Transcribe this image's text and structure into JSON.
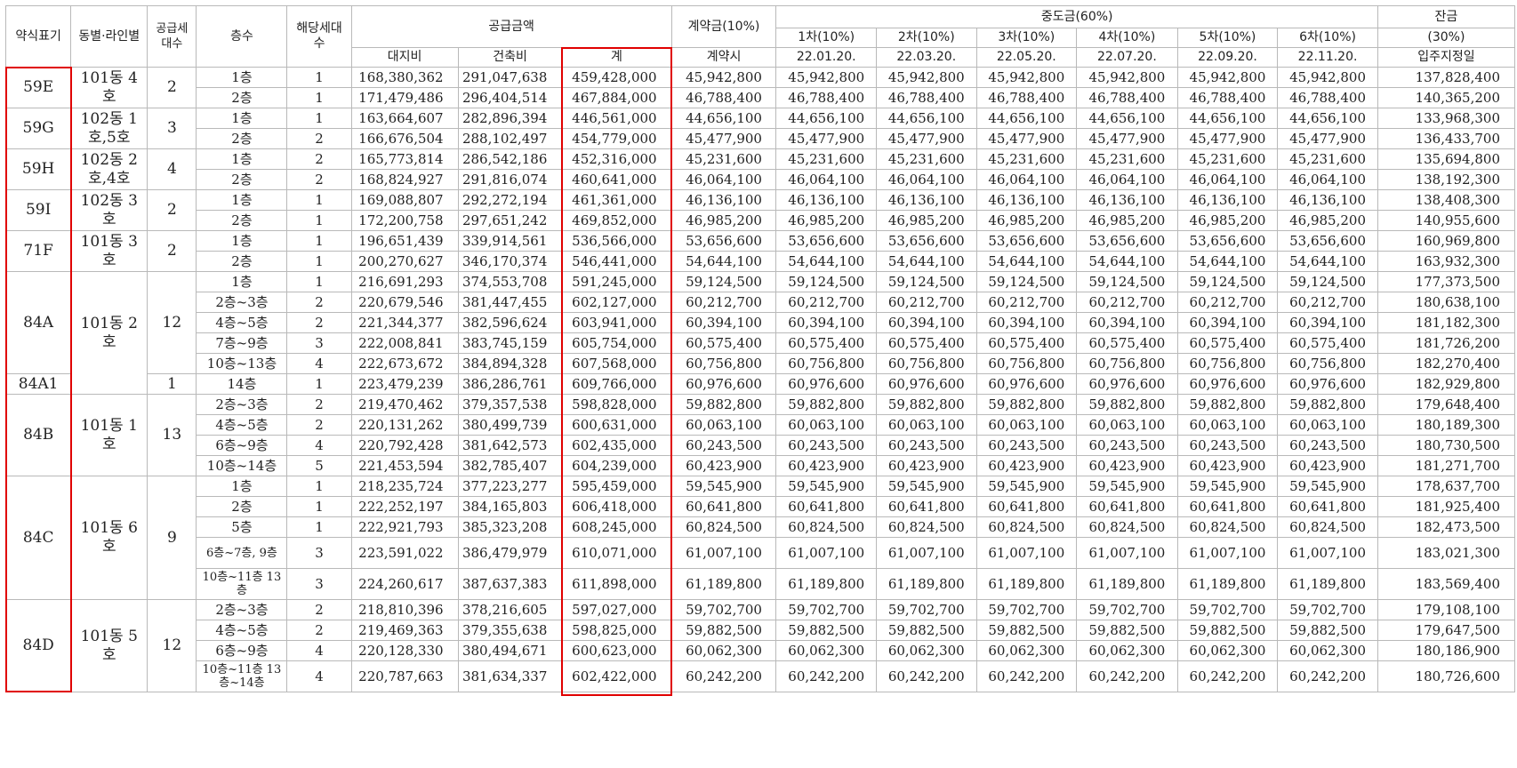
{
  "header": {
    "type": "약식표기",
    "dong_line": "동별·라인별",
    "units_total": "공급세대수",
    "floor": "층수",
    "units": "해당세대수",
    "supply": "공급금액",
    "land": "대지비",
    "building": "건축비",
    "total": "계",
    "contract": "계약금(10%)",
    "contract_sub": "계약시",
    "middle": "중도금(60%)",
    "middle_installments": [
      {
        "label": "1차(10%)",
        "date": "22.01.20."
      },
      {
        "label": "2차(10%)",
        "date": "22.03.20."
      },
      {
        "label": "3차(10%)",
        "date": "22.05.20."
      },
      {
        "label": "4차(10%)",
        "date": "22.07.20."
      },
      {
        "label": "5차(10%)",
        "date": "22.09.20."
      },
      {
        "label": "6차(10%)",
        "date": "22.11.20."
      }
    ],
    "balance_l1": "잔금",
    "balance_l2": "(30%)",
    "balance_sub": "입주지정일"
  },
  "groups": [
    {
      "type": "59E",
      "dong": "101동 4호",
      "total_units": "2",
      "rows": [
        {
          "floor": "1층",
          "units": "1",
          "land": "168,380,362",
          "building": "291,047,638",
          "total": "459,428,000",
          "contract": "45,942,800",
          "middle": "45,942,800",
          "balance": "137,828,400"
        },
        {
          "floor": "2층",
          "units": "1",
          "land": "171,479,486",
          "building": "296,404,514",
          "total": "467,884,000",
          "contract": "46,788,400",
          "middle": "46,788,400",
          "balance": "140,365,200"
        }
      ]
    },
    {
      "type": "59G",
      "dong": "102동 1호,5호",
      "total_units": "3",
      "rows": [
        {
          "floor": "1층",
          "units": "1",
          "land": "163,664,607",
          "building": "282,896,394",
          "total": "446,561,000",
          "contract": "44,656,100",
          "middle": "44,656,100",
          "balance": "133,968,300"
        },
        {
          "floor": "2층",
          "units": "2",
          "land": "166,676,504",
          "building": "288,102,497",
          "total": "454,779,000",
          "contract": "45,477,900",
          "middle": "45,477,900",
          "balance": "136,433,700"
        }
      ]
    },
    {
      "type": "59H",
      "dong": "102동 2호,4호",
      "total_units": "4",
      "rows": [
        {
          "floor": "1층",
          "units": "2",
          "land": "165,773,814",
          "building": "286,542,186",
          "total": "452,316,000",
          "contract": "45,231,600",
          "middle": "45,231,600",
          "balance": "135,694,800"
        },
        {
          "floor": "2층",
          "units": "2",
          "land": "168,824,927",
          "building": "291,816,074",
          "total": "460,641,000",
          "contract": "46,064,100",
          "middle": "46,064,100",
          "balance": "138,192,300"
        }
      ]
    },
    {
      "type": "59I",
      "dong": "102동 3호",
      "total_units": "2",
      "rows": [
        {
          "floor": "1층",
          "units": "1",
          "land": "169,088,807",
          "building": "292,272,194",
          "total": "461,361,000",
          "contract": "46,136,100",
          "middle": "46,136,100",
          "balance": "138,408,300"
        },
        {
          "floor": "2층",
          "units": "1",
          "land": "172,200,758",
          "building": "297,651,242",
          "total": "469,852,000",
          "contract": "46,985,200",
          "middle": "46,985,200",
          "balance": "140,955,600"
        }
      ]
    },
    {
      "type": "71F",
      "dong": "101동 3호",
      "total_units": "2",
      "rows": [
        {
          "floor": "1층",
          "units": "1",
          "land": "196,651,439",
          "building": "339,914,561",
          "total": "536,566,000",
          "contract": "53,656,600",
          "middle": "53,656,600",
          "balance": "160,969,800"
        },
        {
          "floor": "2층",
          "units": "1",
          "land": "200,270,627",
          "building": "346,170,374",
          "total": "546,441,000",
          "contract": "54,644,100",
          "middle": "54,644,100",
          "balance": "163,932,300"
        }
      ]
    },
    {
      "type": "84A",
      "dong": "101동 2호",
      "total_units": "12",
      "rows": [
        {
          "floor": "1층",
          "units": "1",
          "land": "216,691,293",
          "building": "374,553,708",
          "total": "591,245,000",
          "contract": "59,124,500",
          "middle": "59,124,500",
          "balance": "177,373,500"
        },
        {
          "floor": "2층~3층",
          "units": "2",
          "land": "220,679,546",
          "building": "381,447,455",
          "total": "602,127,000",
          "contract": "60,212,700",
          "middle": "60,212,700",
          "balance": "180,638,100"
        },
        {
          "floor": "4층~5층",
          "units": "2",
          "land": "221,344,377",
          "building": "382,596,624",
          "total": "603,941,000",
          "contract": "60,394,100",
          "middle": "60,394,100",
          "balance": "181,182,300"
        },
        {
          "floor": "7층~9층",
          "units": "3",
          "land": "222,008,841",
          "building": "383,745,159",
          "total": "605,754,000",
          "contract": "60,575,400",
          "middle": "60,575,400",
          "balance": "181,726,200"
        },
        {
          "floor": "10층~13층",
          "units": "4",
          "land": "222,673,672",
          "building": "384,894,328",
          "total": "607,568,000",
          "contract": "60,756,800",
          "middle": "60,756,800",
          "balance": "182,270,400"
        }
      ]
    },
    {
      "type": "84A1",
      "dong": "",
      "total_units": "1",
      "rows": [
        {
          "floor": "14층",
          "units": "1",
          "land": "223,479,239",
          "building": "386,286,761",
          "total": "609,766,000",
          "contract": "60,976,600",
          "middle": "60,976,600",
          "balance": "182,929,800"
        }
      ]
    },
    {
      "type": "84B",
      "dong": "101동 1호",
      "total_units": "13",
      "rows": [
        {
          "floor": "2층~3층",
          "units": "2",
          "land": "219,470,462",
          "building": "379,357,538",
          "total": "598,828,000",
          "contract": "59,882,800",
          "middle": "59,882,800",
          "balance": "179,648,400"
        },
        {
          "floor": "4층~5층",
          "units": "2",
          "land": "220,131,262",
          "building": "380,499,739",
          "total": "600,631,000",
          "contract": "60,063,100",
          "middle": "60,063,100",
          "balance": "180,189,300"
        },
        {
          "floor": "6층~9층",
          "units": "4",
          "land": "220,792,428",
          "building": "381,642,573",
          "total": "602,435,000",
          "contract": "60,243,500",
          "middle": "60,243,500",
          "balance": "180,730,500"
        },
        {
          "floor": "10층~14층",
          "units": "5",
          "land": "221,453,594",
          "building": "382,785,407",
          "total": "604,239,000",
          "contract": "60,423,900",
          "middle": "60,423,900",
          "balance": "181,271,700"
        }
      ]
    },
    {
      "type": "84C",
      "dong": "101동 6호",
      "total_units": "9",
      "rows": [
        {
          "floor": "1층",
          "units": "1",
          "land": "218,235,724",
          "building": "377,223,277",
          "total": "595,459,000",
          "contract": "59,545,900",
          "middle": "59,545,900",
          "balance": "178,637,700"
        },
        {
          "floor": "2층",
          "units": "1",
          "land": "222,252,197",
          "building": "384,165,803",
          "total": "606,418,000",
          "contract": "60,641,800",
          "middle": "60,641,800",
          "balance": "181,925,400"
        },
        {
          "floor": "5층",
          "units": "1",
          "land": "222,921,793",
          "building": "385,323,208",
          "total": "608,245,000",
          "contract": "60,824,500",
          "middle": "60,824,500",
          "balance": "182,473,500"
        },
        {
          "floor": "6층~7층, 9층",
          "units": "3",
          "land": "223,591,022",
          "building": "386,479,979",
          "total": "610,071,000",
          "contract": "61,007,100",
          "middle": "61,007,100",
          "balance": "183,021,300",
          "tall": true
        },
        {
          "floor": "10층~11층 13층",
          "units": "3",
          "land": "224,260,617",
          "building": "387,637,383",
          "total": "611,898,000",
          "contract": "61,189,800",
          "middle": "61,189,800",
          "balance": "183,569,400",
          "tall": true
        }
      ]
    },
    {
      "type": "84D",
      "dong": "101동 5호",
      "total_units": "12",
      "rows": [
        {
          "floor": "2층~3층",
          "units": "2",
          "land": "218,810,396",
          "building": "378,216,605",
          "total": "597,027,000",
          "contract": "59,702,700",
          "middle": "59,702,700",
          "balance": "179,108,100"
        },
        {
          "floor": "4층~5층",
          "units": "2",
          "land": "219,469,363",
          "building": "379,355,638",
          "total": "598,825,000",
          "contract": "59,882,500",
          "middle": "59,882,500",
          "balance": "179,647,500"
        },
        {
          "floor": "6층~9층",
          "units": "4",
          "land": "220,128,330",
          "building": "380,494,671",
          "total": "600,623,000",
          "contract": "60,062,300",
          "middle": "60,062,300",
          "balance": "180,186,900"
        },
        {
          "floor": "10층~11층 13층~14층",
          "units": "4",
          "land": "220,787,663",
          "building": "381,634,337",
          "total": "602,422,000",
          "contract": "60,242,200",
          "middle": "60,242,200",
          "balance": "180,726,600",
          "tall": true
        }
      ]
    }
  ],
  "highlight_color": "#e00000"
}
